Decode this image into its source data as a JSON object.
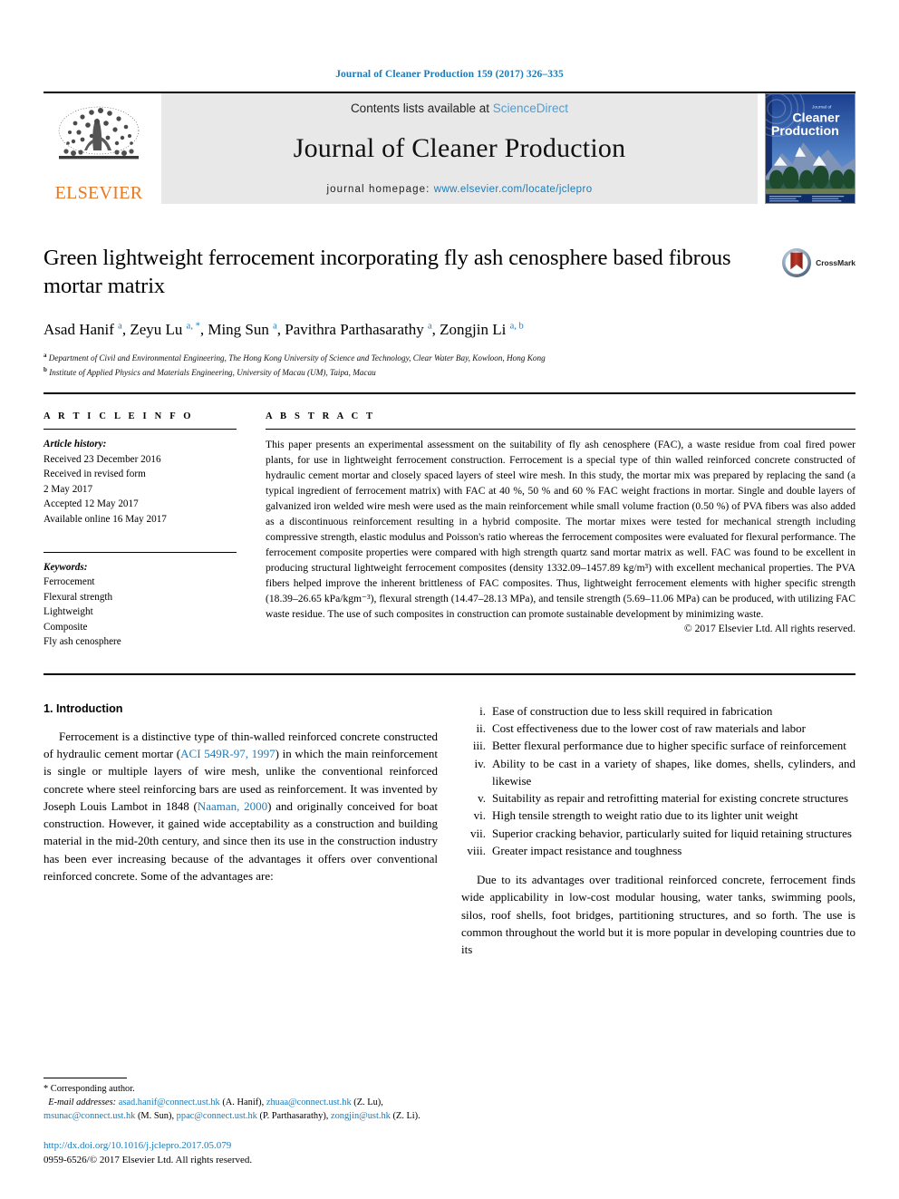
{
  "running_head": "Journal of Cleaner Production 159 (2017) 326–335",
  "masthead": {
    "contents_prefix": "Contents lists available at ",
    "sciencedirect": "ScienceDirect",
    "journal_title": "Journal of Cleaner Production",
    "homepage_prefix": "journal homepage: ",
    "homepage_url": "www.elsevier.com/locate/jclepro",
    "publisher": "ELSEVIER",
    "cover_title_small": "Journal of",
    "cover_title_line1": "Cleaner",
    "cover_title_line2": "Production"
  },
  "article": {
    "title": "Green lightweight ferrocement incorporating fly ash cenosphere based fibrous mortar matrix",
    "crossmark_label": "CrossMark",
    "authors_html": "Asad Hanif <sup>a</sup>, Zeyu Lu <sup>a, *</sup>, Ming Sun <sup>a</sup>, Pavithra Parthasarathy <sup>a</sup>, Zongjin Li <sup>a, b</sup>",
    "affiliation_a": "Department of Civil and Environmental Engineering, The Hong Kong University of Science and Technology, Clear Water Bay, Kowloon, Hong Kong",
    "affiliation_b": "Institute of Applied Physics and Materials Engineering, University of Macau (UM), Taipa, Macau"
  },
  "article_info": {
    "heading": "A R T I C L E   I N F O",
    "history_label": "Article history:",
    "history": [
      "Received 23 December 2016",
      "Received in revised form",
      "2 May 2017",
      "Accepted 12 May 2017",
      "Available online 16 May 2017"
    ],
    "keywords_label": "Keywords:",
    "keywords": [
      "Ferrocement",
      "Flexural strength",
      "Lightweight",
      "Composite",
      "Fly ash cenosphere"
    ]
  },
  "abstract": {
    "heading": "A B S T R A C T",
    "body": "This paper presents an experimental assessment on the suitability of fly ash cenosphere (FAC), a waste residue from coal fired power plants, for use in lightweight ferrocement construction. Ferrocement is a special type of thin walled reinforced concrete constructed of hydraulic cement mortar and closely spaced layers of steel wire mesh. In this study, the mortar mix was prepared by replacing the sand (a typical ingredient of ferrocement matrix) with FAC at 40 %, 50 % and 60 % FAC weight fractions in mortar. Single and double layers of galvanized iron welded wire mesh were used as the main reinforcement while small volume fraction (0.50 %) of PVA fibers was also added as a discontinuous reinforcement resulting in a hybrid composite. The mortar mixes were tested for mechanical strength including compressive strength, elastic modulus and Poisson's ratio whereas the ferrocement composites were evaluated for flexural performance. The ferrocement composite properties were compared with high strength quartz sand mortar matrix as well. FAC was found to be excellent in producing structural lightweight ferrocement composites (density 1332.09–1457.89 kg/m³) with excellent mechanical properties. The PVA fibers helped improve the inherent brittleness of FAC composites. Thus, lightweight ferrocement elements with higher specific strength (18.39–26.65 kPa/kgm⁻³), flexural strength (14.47–28.13 MPa), and tensile strength (5.69–11.06 MPa) can be produced, with utilizing FAC waste residue. The use of such composites in construction can promote sustainable development by minimizing waste.",
    "copyright": "© 2017 Elsevier Ltd. All rights reserved."
  },
  "introduction": {
    "heading": "1. Introduction",
    "paragraph_parts": {
      "p1a": "Ferrocement is a distinctive type of thin-walled reinforced concrete constructed of hydraulic cement mortar (",
      "p1_ref1": "ACI 549R-97, 1997",
      "p1b": ") in which the main reinforcement is single or multiple layers of wire mesh, unlike the conventional reinforced concrete where steel reinforcing bars are used as reinforcement. It was invented by Joseph Louis Lambot in 1848 (",
      "p1_ref2": "Naaman, 2000",
      "p1c": ") and originally conceived for boat construction. However, it gained wide acceptability as a construction and building material in the mid-20th century, and since then its use in the construction industry has been ever increasing because of the advantages it offers over conventional reinforced concrete. Some of the advantages are:"
    }
  },
  "advantages": [
    {
      "num": "i.",
      "text": "Ease of construction due to less skill required in fabrication"
    },
    {
      "num": "ii.",
      "text": "Cost effectiveness due to the lower cost of raw materials and labor"
    },
    {
      "num": "iii.",
      "text": "Better flexural performance due to higher specific surface of reinforcement"
    },
    {
      "num": "iv.",
      "text": "Ability to be cast in a variety of shapes, like domes, shells, cylinders, and likewise"
    },
    {
      "num": "v.",
      "text": "Suitability as repair and retrofitting material for existing concrete structures"
    },
    {
      "num": "vi.",
      "text": "High tensile strength to weight ratio due to its lighter unit weight"
    },
    {
      "num": "vii.",
      "text": "Superior cracking behavior, particularly suited for liquid retaining structures"
    },
    {
      "num": "viii.",
      "text": "Greater impact resistance and toughness"
    }
  ],
  "right_column_paragraph": "Due to its advantages over traditional reinforced concrete, ferrocement finds wide applicability in low-cost modular housing, water tanks, swimming pools, silos, roof shells, foot bridges, partitioning structures, and so forth. The use is common throughout the world but it is more popular in developing countries due to its",
  "footnote": {
    "corresponding": "* Corresponding author.",
    "email_label": "E-mail addresses:",
    "emails": [
      {
        "addr": "asad.hanif@connect.ust.hk",
        "name": " (A. Hanif), "
      },
      {
        "addr": "zhuaa@connect.ust.hk",
        "name": " (Z. Lu), "
      },
      {
        "addr": "msunac@connect.ust.hk",
        "name": " (M. Sun), "
      },
      {
        "addr": "ppac@connect.ust.hk",
        "name": " (P. Parthasarathy), "
      },
      {
        "addr": "zongjin@ust.hk",
        "name": " (Z. Li)."
      }
    ],
    "doi": "http://dx.doi.org/10.1016/j.jclepro.2017.05.079",
    "issn": "0959-6526/© 2017 Elsevier Ltd. All rights reserved."
  },
  "colors": {
    "link_blue": "#1a7bb9",
    "sciencedirect_blue": "#4a9ed4",
    "elsevier_orange": "#E87722",
    "masthead_gray": "#e8e8e8",
    "crossmark_red": "#b02a1a"
  }
}
